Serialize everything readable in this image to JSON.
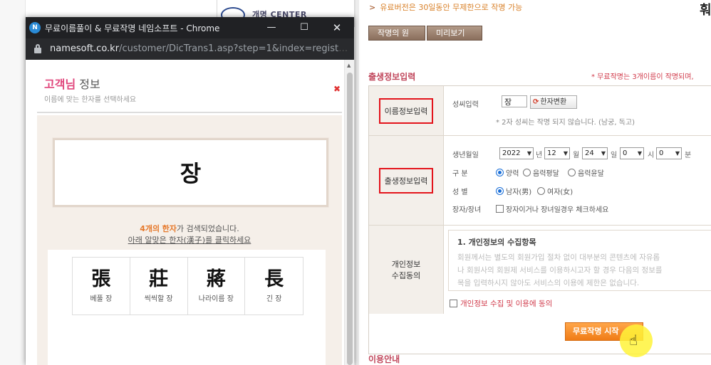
{
  "background": {
    "center_label": "개명 CENTER",
    "notice": "유료버전은 30일동안 무제한으로 작명 가능",
    "notice_arrow": ">",
    "corner_glyph": "훠",
    "buttons": {
      "principle": "작명의 원리",
      "preview": "미리보기"
    },
    "section_title": "출생정보입력",
    "section_note": "* 무료작명는 3개이름이 작명되며,",
    "form": {
      "name_info": {
        "header": "이름정보입력",
        "surname_label": "성씨입력",
        "surname_value": "장",
        "hanja_button": "한자변환",
        "hint": "* 2자 성씨는 작명 되지 않습니다. (남궁, 독고)"
      },
      "birth_info": {
        "header": "출생정보입력",
        "date_label": "생년월일",
        "year": "2022",
        "year_unit": "년",
        "month": "12",
        "month_unit": "월",
        "day": "24",
        "day_unit": "일",
        "hour": "0",
        "hour_unit": "시",
        "minute": "0",
        "minute_unit": "분",
        "calendar_label": "구 분",
        "calendar_options": [
          "양력",
          "음력평달",
          "음력윤달"
        ],
        "gender_label": "성 별",
        "gender_options": [
          "남자(男)",
          "여자(女)"
        ],
        "firstborn_label": "장자/장녀",
        "firstborn_text": "장자이거나 장녀일경우 체크하세요"
      },
      "consent": {
        "header_line1": "개인정보",
        "header_line2": "수집동의",
        "title": "1. 개인정보의 수집항목",
        "lines": [
          "회원께서는 별도의 회원가입 절차 없이 대부분의 콘텐츠에 자유롭",
          "나 회원사의 회원제 서비스를 이용하시고자 할 경우 다음의 정보를",
          "목을 입력하시지 않아도 서비스의 이용에 제한은 없습니다."
        ],
        "agree_text": "개인정보 수집 및 이용에 동의"
      }
    },
    "start_button": "무료작명 시작",
    "usage_title": "이용안내"
  },
  "popup": {
    "window_title": "무료이름풀이 & 무료작명 네임소프트 - Chrome",
    "app_icon_letter": "N",
    "url_host": "namesoft.co.kr",
    "url_path": "/customer/DicTrans1.asp?step=1&index=register...",
    "title_pink": "고객님",
    "title_rest": " 정보",
    "subtitle": "이름에 맞는 한자를 선택하세요",
    "close_mark": "✖",
    "name_char": "장",
    "count_number": "4개의",
    "count_word": "한자",
    "count_rest": "가 검색되었습니다.",
    "click_instruction": "아래 알맞은 한자(漢子)를 클릭하세요",
    "hanja": [
      {
        "char": "張",
        "meaning": "베풀 장"
      },
      {
        "char": "莊",
        "meaning": "씩씩할 장"
      },
      {
        "char": "蔣",
        "meaning": "나라이름 장"
      },
      {
        "char": "長",
        "meaning": "긴 장"
      }
    ]
  },
  "icons": {
    "app": "namesoft-app-icon",
    "lock": "lock-icon",
    "minimize": "minimize-icon",
    "maximize": "maximize-icon",
    "close": "close-icon",
    "cursor": "hand-pointer-icon"
  },
  "colors": {
    "accent_pink": "#e0457b",
    "section_red": "#c0455a",
    "start_orange": "#f07c16",
    "highlight_box": "#e3141c",
    "titlebar": "#202124"
  }
}
